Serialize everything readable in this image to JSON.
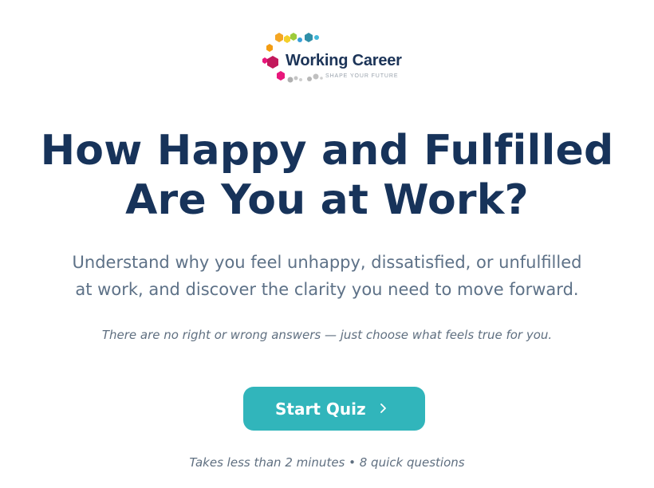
{
  "logo": {
    "name": "Working Career",
    "tagline": "SHAPE YOUR FUTURE",
    "icon": "hexagon-cluster-logo",
    "colors": [
      "#f5a623",
      "#f3d02b",
      "#9ccb3a",
      "#3a9fd8",
      "#2f8fa8",
      "#e8177b",
      "#c2185b",
      "#b0b0b0"
    ]
  },
  "hero": {
    "title_line1": "How Happy and Fulfilled",
    "title_line2": "Are You at Work?",
    "subtitle_line1": "Understand why you feel unhappy, dissatisfied, or unfulfilled",
    "subtitle_line2": "at work, and discover the clarity you need to move forward.",
    "note": "There are no right or wrong answers — just choose what feels true for you."
  },
  "cta": {
    "label": "Start Quiz",
    "icon": "chevron-right-icon",
    "color": "#31b5bb"
  },
  "footnote": "Takes less than 2 minutes • 8 quick questions",
  "theme": {
    "heading": "#17335a",
    "body": "#5d7187",
    "muted": "#5f6f80",
    "background": "#ffffff"
  }
}
